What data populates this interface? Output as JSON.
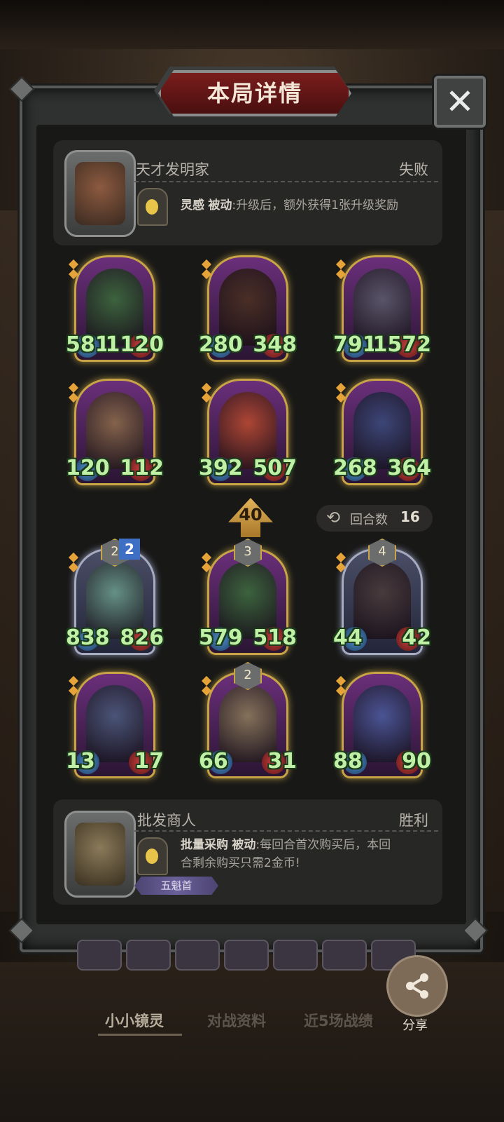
{
  "header": {
    "title": "本局详情",
    "close_icon": "close-icon"
  },
  "opponent": {
    "name": "天才发明家",
    "result": "失败",
    "skill_name": "灵感",
    "skill_type": "被动",
    "skill_desc": ":升级后，额外获得1张升级奖励"
  },
  "opponent_units": [
    {
      "atk": "581",
      "hp": "1120",
      "frame": "gold",
      "art": "#3a6a3a"
    },
    {
      "atk": "280",
      "hp": "348",
      "frame": "gold",
      "art": "#4a3020"
    },
    {
      "atk": "791",
      "hp": "1572",
      "frame": "gold",
      "art": "#5a5a6a"
    },
    {
      "atk": "120",
      "hp": "112",
      "frame": "gold",
      "art": "#8a6a4a"
    },
    {
      "atk": "392",
      "hp": "507",
      "frame": "gold",
      "art": "#b84a30"
    },
    {
      "atk": "268",
      "hp": "364",
      "frame": "gold",
      "art": "#3a4a7a"
    }
  ],
  "center": {
    "level": "40",
    "round_label": "回合数",
    "round_value": "16"
  },
  "player_units": [
    {
      "atk": "838",
      "hp": "826",
      "level": "2",
      "frame": "silver",
      "art": "#6a9a8a",
      "badge": "2"
    },
    {
      "atk": "579",
      "hp": "518",
      "level": "3",
      "frame": "gold",
      "art": "#3a6a3a"
    },
    {
      "atk": "44",
      "hp": "42",
      "level": "4",
      "frame": "silver",
      "art": "#4a3a3a"
    },
    {
      "atk": "13",
      "hp": "17",
      "level": "",
      "frame": "gold",
      "art": "#4a5a7a"
    },
    {
      "atk": "66",
      "hp": "31",
      "level": "2",
      "frame": "gold",
      "art": "#8a7a5a"
    },
    {
      "atk": "88",
      "hp": "90",
      "level": "",
      "frame": "gold",
      "art": "#4a5a9a"
    }
  ],
  "player": {
    "name": "批发商人",
    "result": "胜利",
    "skill_name": "批量采购",
    "skill_type": "被动",
    "skill_desc_line1": ":每回合首次购买后，本回",
    "skill_desc_line2": "合剩余购买只需2金币!",
    "rank_badge": "五魁首"
  },
  "bottom_tabs": [
    "小小镜灵",
    "对战资料",
    "近5场战绩"
  ],
  "share": {
    "label": "分享",
    "icon": "share-icon"
  },
  "colors": {
    "stat_green": "#bff0a6",
    "banner_red": "#7a1d1d",
    "gold_frame": "#c9a447"
  }
}
